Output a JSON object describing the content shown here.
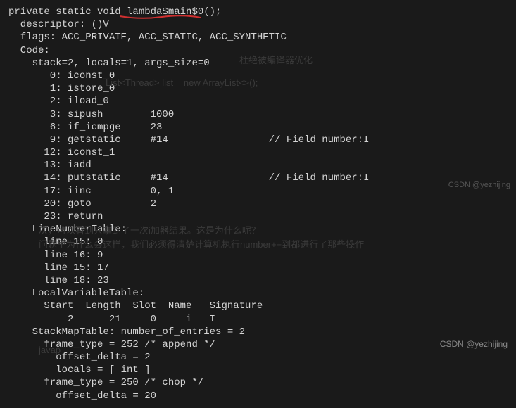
{
  "code": {
    "l1": "private static void lambda$main$0();",
    "l2": "  descriptor: ()V",
    "l3": "  flags: ACC_PRIVATE, ACC_STATIC, ACC_SYNTHETIC",
    "l4": "  Code:",
    "l5": "    stack=2, locals=1, args_size=0",
    "l6": "       0: iconst_0",
    "l7": "       1: istore_0",
    "l8": "       2: iload_0",
    "l9": "       3: sipush        1000",
    "l10": "       6: if_icmpge     23",
    "l11": "       9: getstatic     #14                 // Field number:I",
    "l12": "      12: iconst_1",
    "l13": "      13: iadd",
    "l14": "      14: putstatic     #14                 // Field number:I",
    "l15": "      17: iinc          0, 1",
    "l16": "      20: goto          2",
    "l17": "      23: return",
    "l18": "    LineNumberTable:",
    "l19": "      line 15: 0",
    "l20": "      line 16: 9",
    "l21": "      line 15: 17",
    "l22": "      line 18: 23",
    "l23": "    LocalVariableTable:",
    "l24": "      Start  Length  Slot  Name   Signature",
    "l25": "          2      21     0     i   I",
    "l26": "    StackMapTable: number_of_entries = 2",
    "l27": "      frame_type = 252 /* append */",
    "l28": "        offset_delta = 2",
    "l29": "        locals = [ int ]",
    "l30": "      frame_type = 250 /* chop */",
    "l31": "        offset_delta = 20"
  },
  "watermark": "CSDN @yezhijing",
  "watermark_mid": "CSDN @yezhijing",
  "ghost": {
    "g1": "杜绝被编译器优化",
    "g2": "List<Thread> list = new ArrayList<>();",
    "g3": "",
    "g4": "次，可以看到只拿到了一次i加器结果。这是为什么呢？",
    "g5": "问题里为什么会这样，我们必须得清楚计算机执行number++到都进行了那些操作",
    "g6": "",
    "g7": "",
    "g8": "",
    "g9": "",
    "g10": "javap"
  }
}
